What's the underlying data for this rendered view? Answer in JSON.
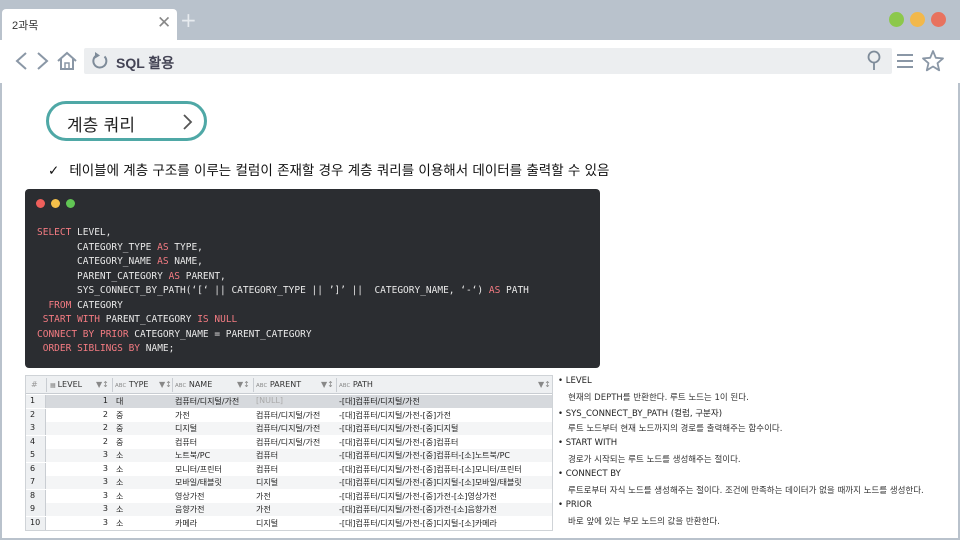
{
  "browser": {
    "tab_title": "2과목",
    "close_glyph": "✕",
    "new_tab_glyph": "+",
    "address": "SQL 활용",
    "window_dots": [
      "#8cc84b",
      "#f2b84b",
      "#e8725e"
    ],
    "icons": [
      "back-arrow-icon",
      "forward-arrow-icon",
      "home-icon",
      "reload-icon",
      "location-pin-icon",
      "menu-icon",
      "star-icon"
    ]
  },
  "page": {
    "heading": "계층 쿼리",
    "check_glyph": "✓",
    "bullet": "테이블에 계층 구조를 이루는 컬럼이 존재할 경우 계층 쿼리를 이용해서 데이터를 출력할 수 있음",
    "accent": "#4fa8a6"
  },
  "code": {
    "dots": [
      "#ee5f5b",
      "#f5c04a",
      "#61c554"
    ],
    "lines": [
      "SELECT LEVEL,",
      "       CATEGORY_TYPE AS TYPE,",
      "       CATEGORY_NAME AS NAME,",
      "       PARENT_CATEGORY AS PARENT,",
      "       SYS_CONNECT_BY_PATH(‘[‘ || CATEGORY_TYPE || ’]’ ||  CATEGORY_NAME, ‘-‘) AS PATH",
      "  FROM CATEGORY",
      " START WITH PARENT_CATEGORY IS NULL",
      "CONNECT BY PRIOR CATEGORY_NAME = PARENT_CATEGORY",
      " ORDER SIBLINGS BY NAME;"
    ]
  },
  "grid": {
    "columns": [
      "LEVEL",
      "TYPE",
      "NAME",
      "PARENT",
      "PATH"
    ],
    "type_prefix": "ABC",
    "rows": [
      {
        "n": "1",
        "level": "1",
        "type": "대",
        "name": "컴퓨터/디지털/가전",
        "parent": "[NULL]",
        "path": "-[대]컴퓨터/디지털/가전"
      },
      {
        "n": "2",
        "level": "2",
        "type": "중",
        "name": "가전",
        "parent": "컴퓨터/디지털/가전",
        "path": "-[대]컴퓨터/디지털/가전-[중]가전"
      },
      {
        "n": "3",
        "level": "2",
        "type": "중",
        "name": "디지털",
        "parent": "컴퓨터/디지털/가전",
        "path": "-[대]컴퓨터/디지털/가전-[중]디지털"
      },
      {
        "n": "4",
        "level": "2",
        "type": "중",
        "name": "컴퓨터",
        "parent": "컴퓨터/디지털/가전",
        "path": "-[대]컴퓨터/디지털/가전-[중]컴퓨터"
      },
      {
        "n": "5",
        "level": "3",
        "type": "소",
        "name": "노트북/PC",
        "parent": "컴퓨터",
        "path": "-[대]컴퓨터/디지털/가전-[중]컴퓨터-[소]노트북/PC"
      },
      {
        "n": "6",
        "level": "3",
        "type": "소",
        "name": "모니터/프린터",
        "parent": "컴퓨터",
        "path": "-[대]컴퓨터/디지털/가전-[중]컴퓨터-[소]모니터/프린터"
      },
      {
        "n": "7",
        "level": "3",
        "type": "소",
        "name": "모바일/태블릿",
        "parent": "디지털",
        "path": "-[대]컴퓨터/디지털/가전-[중]디지털-[소]모바일/태블릿"
      },
      {
        "n": "8",
        "level": "3",
        "type": "소",
        "name": "영상가전",
        "parent": "가전",
        "path": "-[대]컴퓨터/디지털/가전-[중]가전-[소]영상가전"
      },
      {
        "n": "9",
        "level": "3",
        "type": "소",
        "name": "음향가전",
        "parent": "가전",
        "path": "-[대]컴퓨터/디지털/가전-[중]가전-[소]음향가전"
      },
      {
        "n": "10",
        "level": "3",
        "type": "소",
        "name": "카메라",
        "parent": "디지털",
        "path": "-[대]컴퓨터/디지털/가전-[중]디지털-[소]카메라"
      }
    ]
  },
  "notes": [
    {
      "title": "• LEVEL",
      "desc": "현재의 DEPTH를 반환한다. 루트 노드는 1이 된다."
    },
    {
      "title": "• SYS_CONNECT_BY_PATH (컬럼, 구분자)",
      "desc": "루트 노드부터 현재 노드까지의 경로를 출력해주는 함수이다."
    },
    {
      "title": "• START WITH",
      "desc": "경로가 시작되는 루트 노드를 생성해주는 절이다."
    },
    {
      "title": "• CONNECT BY",
      "desc": "루트로부터 자식 노드를 생성해주는 절이다. 조건에 만족하는 데이터가 없을 때까지 노드를 생성한다."
    },
    {
      "title": "• PRIOR",
      "desc": "바로 앞에 있는 부모 노드의 값을 반환한다."
    }
  ]
}
